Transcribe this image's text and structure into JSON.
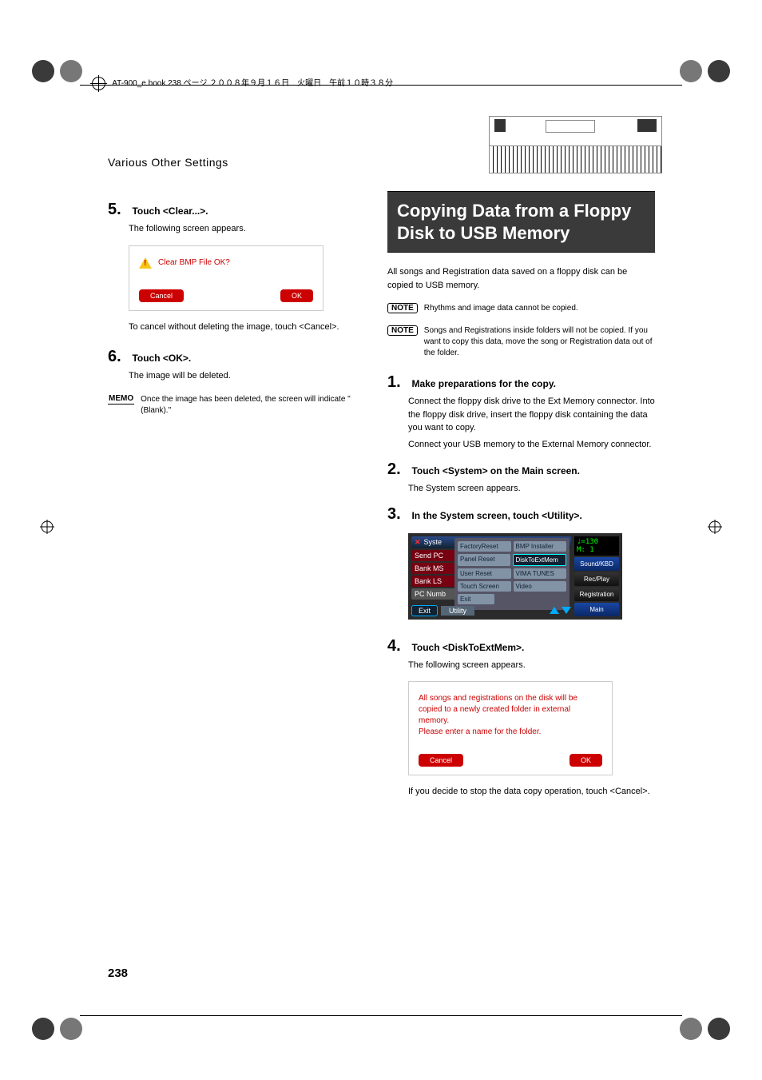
{
  "header_line": "AT-900_e.book 238 ページ ２００８年９月１６日　火曜日　午前１０時３８分",
  "section_header": "Various Other Settings",
  "page_number": "238",
  "left": {
    "step5_num": "5.",
    "step5_head": "Touch <Clear...>.",
    "step5_text": "The following screen appears.",
    "dialog1_text": "Clear BMP File OK?",
    "dialog1_cancel": "Cancel",
    "dialog1_ok": "OK",
    "step5_after": "To cancel without deleting the image, touch <Cancel>.",
    "step6_num": "6.",
    "step6_head": "Touch <OK>.",
    "step6_text": "The image will be deleted.",
    "memo_label": "MEMO",
    "memo_text": "Once the image has been deleted, the screen will indicate \"(Blank).\""
  },
  "right": {
    "feature_title": "Copying Data from a Floppy Disk to USB Memory",
    "intro": "All songs and Registration data saved on a floppy disk can be copied to USB memory.",
    "note_label": "NOTE",
    "note1": "Rhythms and image data cannot be copied.",
    "note2": "Songs and Registrations inside folders will not be copied. If you want to copy this data, move the song or Registration data out of the folder.",
    "step1_num": "1.",
    "step1_head": "Make preparations for the copy.",
    "step1_text1": "Connect the floppy disk drive to the Ext Memory connector. Into the floppy disk drive, insert the floppy disk containing the data you want to copy.",
    "step1_text2": "Connect your USB memory to the External Memory connector.",
    "step2_num": "2.",
    "step2_head": "Touch <System> on the Main screen.",
    "step2_text": "The System screen appears.",
    "step3_num": "3.",
    "step3_head": "In the System screen, touch <Utility>.",
    "sys": {
      "title": "Syste",
      "tabs": [
        "Send PC",
        "Bank MS",
        "Bank LS",
        "PC Numb"
      ],
      "menu": [
        [
          "FactoryReset",
          "BMP Installer"
        ],
        [
          "Panel Reset",
          "DiskToExtMem"
        ],
        [
          "User Reset",
          "VIMA TUNES"
        ],
        [
          "Touch Screen",
          "Video"
        ],
        [
          "Exit",
          ""
        ]
      ],
      "footer_exit": "Exit",
      "footer_utility": "Utility",
      "tempo": "♩=130",
      "measure": "M:    1",
      "side": [
        "Sound/KBD",
        "Rec/Play",
        "Registration",
        "Main"
      ]
    },
    "step4_num": "4.",
    "step4_head": "Touch <DiskToExtMem>.",
    "step4_text": "The following screen appears.",
    "dialog2_text": "All songs and registrations on the disk will be copied to a newly created folder in external memory.\nPlease enter a name for the folder.",
    "dialog2_cancel": "Cancel",
    "dialog2_ok": "OK",
    "step4_after": "If you decide to stop the data copy operation, touch <Cancel>."
  }
}
